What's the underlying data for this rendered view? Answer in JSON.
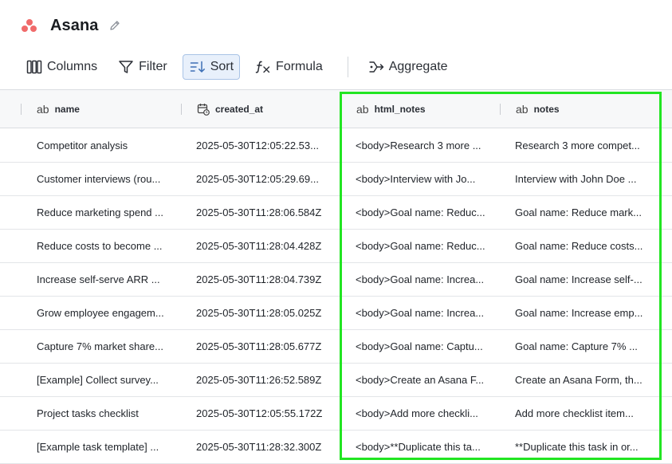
{
  "header": {
    "title": "Asana"
  },
  "toolbar": {
    "columns_label": "Columns",
    "filter_label": "Filter",
    "sort_label": "Sort",
    "formula_label": "Formula",
    "aggregate_label": "Aggregate"
  },
  "columns": [
    {
      "label": "name",
      "type_icon": "text-type-icon"
    },
    {
      "label": "created_at",
      "type_icon": "calendar-clock-icon"
    },
    {
      "label": "html_notes",
      "type_icon": "text-type-icon"
    },
    {
      "label": "notes",
      "type_icon": "text-type-icon"
    }
  ],
  "type_glyph": "ab",
  "rows": [
    {
      "name": "Competitor analysis",
      "created_at": "2025-05-30T12:05:22.53...",
      "html_notes": "<body>Research 3 more ...",
      "notes": "Research 3 more compet..."
    },
    {
      "name": "Customer interviews (rou...",
      "created_at": "2025-05-30T12:05:29.69...",
      "html_notes": "<body>Interview with Jo...",
      "notes": "Interview with John Doe ..."
    },
    {
      "name": "Reduce marketing spend ...",
      "created_at": "2025-05-30T11:28:06.584Z",
      "html_notes": "<body>Goal name: Reduc...",
      "notes": "Goal name: Reduce mark..."
    },
    {
      "name": "Reduce costs to become ...",
      "created_at": "2025-05-30T11:28:04.428Z",
      "html_notes": "<body>Goal name: Reduc...",
      "notes": "Goal name: Reduce costs..."
    },
    {
      "name": "Increase self-serve ARR ...",
      "created_at": "2025-05-30T11:28:04.739Z",
      "html_notes": "<body>Goal name: Increa...",
      "notes": "Goal name: Increase self-..."
    },
    {
      "name": "Grow employee engagem...",
      "created_at": "2025-05-30T11:28:05.025Z",
      "html_notes": "<body>Goal name: Increa...",
      "notes": "Goal name: Increase emp..."
    },
    {
      "name": "Capture 7% market share...",
      "created_at": "2025-05-30T11:28:05.677Z",
      "html_notes": "<body>Goal name: Captu...",
      "notes": "Goal name: Capture 7% ..."
    },
    {
      "name": "[Example] Collect survey...",
      "created_at": "2025-05-30T11:26:52.589Z",
      "html_notes": "<body>Create an Asana F...",
      "notes": "Create an Asana Form, th..."
    },
    {
      "name": "Project tasks checklist",
      "created_at": "2025-05-30T12:05:55.172Z",
      "html_notes": "<body>Add more checkli...",
      "notes": "Add more checklist item..."
    },
    {
      "name": "[Example task template] ...",
      "created_at": "2025-05-30T11:28:32.300Z",
      "html_notes": "<body>**Duplicate this ta...",
      "notes": "**Duplicate this task in or..."
    }
  ],
  "colors": {
    "selection_outline": "#22e522",
    "sort_active_bg": "#e8f0fb",
    "logo": "#f06a6a"
  }
}
